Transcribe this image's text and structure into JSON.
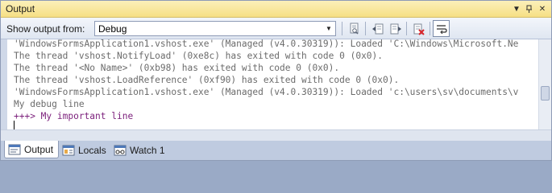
{
  "window": {
    "title": "Output"
  },
  "toolbar": {
    "show_output_label": "Show output from:",
    "source_selected": "Debug"
  },
  "output": {
    "lines": [
      "'WindowsFormsApplication1.vshost.exe' (Managed (v4.0.30319)): Loaded 'C:\\Windows\\Microsoft.Ne",
      "The thread 'vshost.NotifyLoad' (0xe8c) has exited with code 0 (0x0).",
      "The thread '<No Name>' (0xb98) has exited with code 0 (0x0).",
      "The thread 'vshost.LoadReference' (0xf90) has exited with code 0 (0x0).",
      "'WindowsFormsApplication1.vshost.exe' (Managed (v4.0.30319)): Loaded 'c:\\users\\sv\\documents\\v",
      "My debug line",
      "+++> My important line"
    ]
  },
  "tabs": [
    {
      "label": "Output",
      "icon": "output-icon",
      "active": true
    },
    {
      "label": "Locals",
      "icon": "locals-icon",
      "active": false
    },
    {
      "label": "Watch 1",
      "icon": "watch-icon",
      "active": false
    }
  ],
  "colors": {
    "title_bar": "#f6df84",
    "debug_line": "#6b6b6b",
    "important_line": "#7b1f7b"
  }
}
